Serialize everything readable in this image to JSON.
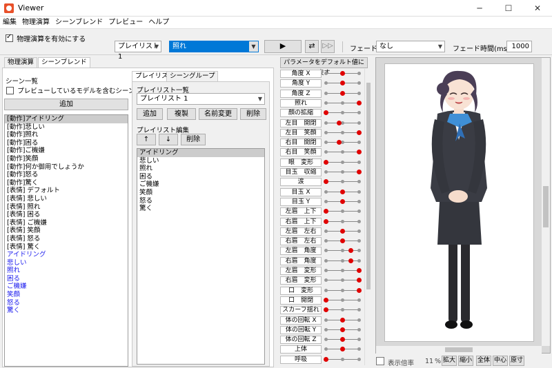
{
  "window": {
    "title": "Viewer",
    "minimize": "─",
    "maximize": "☐",
    "close": "✕"
  },
  "menu": [
    "編集",
    "物理演算",
    "シーンブレンド",
    "プレビュー",
    "ヘルプ"
  ],
  "toolbar": {
    "physics_label": "物理演算を有効にする",
    "playlist_select": "プレイリスト 1",
    "scene_select": "照れ",
    "fade_label": "フェード：",
    "fade_select": "なし",
    "fade_time_label": "フェード時間(ms)：",
    "fade_time_value": "1000"
  },
  "left_tabs": [
    "物理演算",
    "シーンブレンド"
  ],
  "scene_list": {
    "title": "シーン一覧",
    "only_preview_label": "プレビューしているモデルを含むシーンのみ表示",
    "add_button": "追加",
    "items": [
      {
        "label": "[動作]アイドリング",
        "blue": false
      },
      {
        "label": "[動作]悲しい",
        "blue": false
      },
      {
        "label": "[動作]照れ",
        "blue": false
      },
      {
        "label": "[動作]困る",
        "blue": false
      },
      {
        "label": "[動作]ご機嫌",
        "blue": false
      },
      {
        "label": "[動作]笑顔",
        "blue": false
      },
      {
        "label": "[動作]何か御用でしょうか",
        "blue": false
      },
      {
        "label": "[動作]怒る",
        "blue": false
      },
      {
        "label": "[動作]驚く",
        "blue": false
      },
      {
        "label": "[表情] デフォルト",
        "blue": false
      },
      {
        "label": "[表情] 悲しい",
        "blue": false
      },
      {
        "label": "[表情] 照れ",
        "blue": false
      },
      {
        "label": "[表情] 困る",
        "blue": false
      },
      {
        "label": "[表情] ご機嫌",
        "blue": false
      },
      {
        "label": "[表情] 笑顔",
        "blue": false
      },
      {
        "label": "[表情] 怒る",
        "blue": false
      },
      {
        "label": "[表情] 驚く",
        "blue": false
      },
      {
        "label": "アイドリング",
        "blue": true
      },
      {
        "label": "悲しい",
        "blue": true
      },
      {
        "label": "照れ",
        "blue": true
      },
      {
        "label": "困る",
        "blue": true
      },
      {
        "label": "ご機嫌",
        "blue": true
      },
      {
        "label": "笑顔",
        "blue": true
      },
      {
        "label": "怒る",
        "blue": true
      },
      {
        "label": "驚く",
        "blue": true
      }
    ]
  },
  "playlist_tabs": [
    "プレイリスト",
    "シーングループ"
  ],
  "playlist": {
    "list_title": "プレイリスト一覧",
    "selected": "プレイリスト 1",
    "buttons": [
      "追加",
      "複製",
      "名前変更",
      "削除"
    ],
    "edit_title": "プレイリスト編集",
    "up": "↑",
    "down": "↓",
    "delete": "削除",
    "items": [
      "アイドリング",
      "悲しい",
      "照れ",
      "困る",
      "ご機嫌",
      "笑顔",
      "怒る",
      "驚く"
    ]
  },
  "params": {
    "reset_button": "パラメータをデフォルト値に戻す",
    "rows": [
      {
        "label": "角度 X",
        "value": 0.5
      },
      {
        "label": "角度 Y",
        "value": 0.5
      },
      {
        "label": "角度 Z",
        "value": 0.5
      },
      {
        "label": "照れ",
        "value": 1.0
      },
      {
        "label": "顔の拡縮",
        "value": 0.0
      },
      {
        "label": "左目　開閉",
        "value": 0.4
      },
      {
        "label": "左目　笑顔",
        "value": 1.0
      },
      {
        "label": "右目　開閉",
        "value": 0.4
      },
      {
        "label": "右目　笑顔",
        "value": 1.0
      },
      {
        "label": "眼　変形",
        "value": 0.0
      },
      {
        "label": "目玉　収縮",
        "value": 1.0
      },
      {
        "label": "涙",
        "value": 0.0
      },
      {
        "label": "目玉 X",
        "value": 0.5
      },
      {
        "label": "目玉 Y",
        "value": 0.5
      },
      {
        "label": "左眉　上下",
        "value": 0.0
      },
      {
        "label": "右眉　上下",
        "value": 0.0
      },
      {
        "label": "左眉　左右",
        "value": 0.5
      },
      {
        "label": "右眉　左右",
        "value": 0.5
      },
      {
        "label": "左眉　角度",
        "value": 0.75
      },
      {
        "label": "右眉　角度",
        "value": 0.75
      },
      {
        "label": "左眉　変形",
        "value": 1.0
      },
      {
        "label": "右眉　変形",
        "value": 1.0
      },
      {
        "label": "口　変形",
        "value": 1.0
      },
      {
        "label": "口　開閉",
        "value": 0.0
      },
      {
        "label": "スカーフ揺れ",
        "value": 0.0
      },
      {
        "label": "体の回転 X",
        "value": 0.5
      },
      {
        "label": "体の回転 Y",
        "value": 0.5
      },
      {
        "label": "体の回転 Z",
        "value": 0.5
      },
      {
        "label": "上体",
        "value": 0.5
      },
      {
        "label": "呼吸",
        "value": 0.0
      }
    ]
  },
  "preview": {
    "zoom_label": "表示倍率",
    "zoom_value": "11",
    "zoom_unit": "%",
    "buttons": [
      "拡大",
      "縮小",
      "全体",
      "中心",
      "原寸"
    ]
  },
  "colors": {
    "selection": "#0078d7",
    "knob": "#e00000",
    "blue_text": "#1a1aee"
  }
}
